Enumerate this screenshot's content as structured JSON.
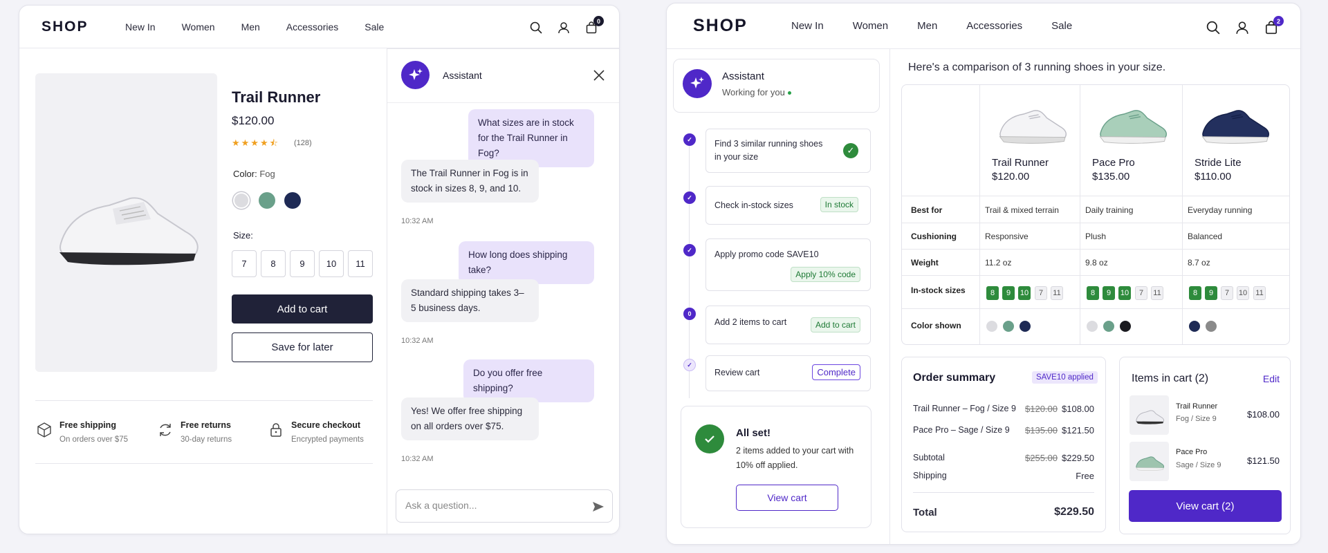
{
  "left": {
    "logo": "SHOP",
    "nav": [
      "New In",
      "Women",
      "Men",
      "Accessories",
      "Sale"
    ],
    "cart_count": "0",
    "product": {
      "title": "Trail Runner",
      "price": "$120.00",
      "rating": 4.5,
      "stars": "★★★★⯪",
      "review_count": "(128)",
      "color_label": "Color:",
      "color_value": "Fog",
      "swatch_colors": [
        "#dcdce0",
        "#6aa08a",
        "#1e2a55"
      ],
      "size_label": "Size:",
      "sizes": [
        "7",
        "8",
        "9",
        "10",
        "11"
      ],
      "add_to_cart": "Add to cart",
      "save_for_later": "Save for later"
    },
    "features": [
      {
        "title": "Free shipping",
        "sub": "On orders over $75",
        "icon": "box-icon"
      },
      {
        "title": "Free returns",
        "sub": "30-day returns",
        "icon": "refresh-icon"
      },
      {
        "title": "Secure checkout",
        "sub": "Encrypted payments",
        "icon": "lock-icon"
      }
    ],
    "chat": {
      "title": "Assistant",
      "messages": [
        {
          "role": "user",
          "text": "What sizes are in stock for the Trail Runner in Fog?"
        },
        {
          "role": "bot",
          "text": "The Trail Runner in Fog is in stock in sizes 8, 9, and 10.",
          "time": "10:32 AM"
        },
        {
          "role": "user",
          "text": "How long does shipping take?"
        },
        {
          "role": "bot",
          "text": "Standard shipping takes 3–5 business days.",
          "time": "10:32 AM"
        },
        {
          "role": "user",
          "text": "Do you offer free shipping?"
        },
        {
          "role": "bot",
          "text": "Yes! We offer free shipping on all orders over $75.",
          "time": "10:32 AM"
        }
      ],
      "input_placeholder": "Ask a question..."
    }
  },
  "right": {
    "logo": "SHOP",
    "nav": [
      "New In",
      "Women",
      "Men",
      "Accessories",
      "Sale"
    ],
    "cart_count": "2",
    "assistant": {
      "title": "Assistant",
      "status": "Working for you"
    },
    "steps": [
      {
        "text": "Find 3 similar running shoes in your size",
        "status": "done",
        "badge": ""
      },
      {
        "text": "Check in-stock sizes",
        "status": "done",
        "badge": "In stock"
      },
      {
        "text": "Apply promo code SAVE10",
        "status": "done",
        "badge": "Apply 10% code"
      },
      {
        "text": "Add 2 items to cart",
        "status": "active",
        "badge": "Add to cart",
        "marker": "0"
      },
      {
        "text": "Review cart",
        "status": "pending",
        "badge": "Complete"
      }
    ],
    "all_set": {
      "title": "All set!",
      "text": "2 items added to your cart with 10% off applied.",
      "button": "View cart"
    },
    "comparison": {
      "heading": "Here's a comparison of 3 running shoes in your size.",
      "shoes": [
        {
          "name": "Trail Runner",
          "price": "$120.00",
          "best_for": "Trail & mixed terrain",
          "cushioning": "Responsive",
          "weight": "11.2 oz",
          "sizes": [
            {
              "s": "8",
              "in": true
            },
            {
              "s": "9",
              "in": true
            },
            {
              "s": "10",
              "in": true
            },
            {
              "s": "7",
              "in": false
            },
            {
              "s": "11",
              "in": false
            }
          ],
          "colors": [
            "#dcdce0",
            "#6aa08a",
            "#1e2a55"
          ]
        },
        {
          "name": "Pace Pro",
          "price": "$135.00",
          "best_for": "Daily training",
          "cushioning": "Plush",
          "weight": "9.8 oz",
          "sizes": [
            {
              "s": "8",
              "in": true
            },
            {
              "s": "9",
              "in": true
            },
            {
              "s": "10",
              "in": true
            },
            {
              "s": "7",
              "in": false
            },
            {
              "s": "11",
              "in": false
            }
          ],
          "colors": [
            "#dcdce0",
            "#6aa08a",
            "#1b1b20"
          ]
        },
        {
          "name": "Stride Lite",
          "price": "$110.00",
          "best_for": "Everyday running",
          "cushioning": "Balanced",
          "weight": "8.7 oz",
          "sizes": [
            {
              "s": "8",
              "in": true
            },
            {
              "s": "9",
              "in": true
            },
            {
              "s": "7",
              "in": false
            },
            {
              "s": "10",
              "in": false
            },
            {
              "s": "11",
              "in": false
            }
          ],
          "colors": [
            "#1e2a55",
            "#8a8a8a"
          ]
        }
      ],
      "row_labels": [
        "Best for",
        "Cushioning",
        "Weight",
        "In-stock sizes",
        "Color shown"
      ]
    },
    "order_summary": {
      "title": "Order summary",
      "promo": "SAVE10 applied",
      "lines": [
        {
          "label": "Trail Runner – Fog / Size 9",
          "old": "$120.00",
          "price": "$108.00"
        },
        {
          "label": "Pace Pro – Sage / Size 9",
          "old": "$135.00",
          "price": "$121.50"
        }
      ],
      "subtotal_label": "Subtotal",
      "subtotal_old": "$255.00",
      "subtotal": "$229.50",
      "shipping_label": "Shipping",
      "shipping": "Free",
      "total_label": "Total",
      "total": "$229.50"
    },
    "items_in_cart": {
      "title": "Items in cart (2)",
      "edit": "Edit",
      "items": [
        {
          "name": "Trail Runner",
          "sub": "Fog / Size 9",
          "price": "$108.00"
        },
        {
          "name": "Pace Pro",
          "sub": "Sage / Size 9",
          "price": "$121.50"
        }
      ],
      "button": "View cart (2)"
    },
    "accent": "#4f28c8",
    "success": "#2e8b3c"
  }
}
